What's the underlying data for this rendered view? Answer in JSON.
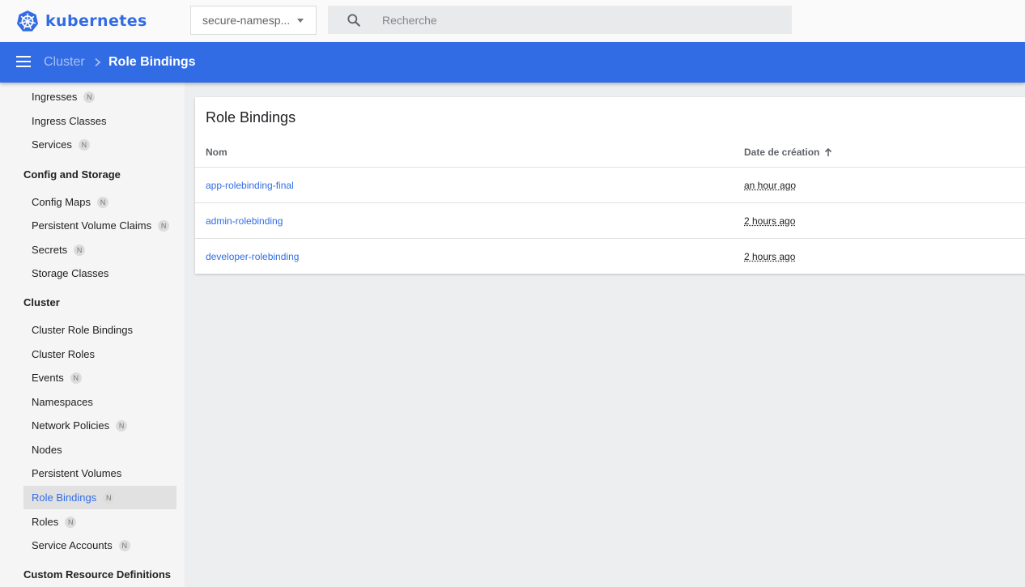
{
  "app": {
    "name": "kubernetes",
    "brand_color": "#326ce5"
  },
  "namespace_select": {
    "value": "secure-namespace",
    "display": "secure-namesp..."
  },
  "search": {
    "placeholder": "Recherche",
    "value": ""
  },
  "breadcrumb": {
    "parent": "Cluster",
    "current": "Role Bindings"
  },
  "sidebar": {
    "items": [
      {
        "label": "Ingresses",
        "badge": "N"
      },
      {
        "label": "Ingress Classes",
        "badge": ""
      },
      {
        "label": "Services",
        "badge": "N"
      },
      {
        "group": "Config and Storage"
      },
      {
        "label": "Config Maps",
        "badge": "N"
      },
      {
        "label": "Persistent Volume Claims",
        "badge": "N"
      },
      {
        "label": "Secrets",
        "badge": "N"
      },
      {
        "label": "Storage Classes",
        "badge": ""
      },
      {
        "group": "Cluster"
      },
      {
        "label": "Cluster Role Bindings",
        "badge": ""
      },
      {
        "label": "Cluster Roles",
        "badge": ""
      },
      {
        "label": "Events",
        "badge": "N"
      },
      {
        "label": "Namespaces",
        "badge": ""
      },
      {
        "label": "Network Policies",
        "badge": "N"
      },
      {
        "label": "Nodes",
        "badge": ""
      },
      {
        "label": "Persistent Volumes",
        "badge": ""
      },
      {
        "label": "Role Bindings",
        "badge": "N",
        "active": true
      },
      {
        "label": "Roles",
        "badge": "N"
      },
      {
        "label": "Service Accounts",
        "badge": "N"
      },
      {
        "group": "Custom Resource Definitions"
      }
    ]
  },
  "card": {
    "title": "Role Bindings",
    "columns": {
      "name": "Nom",
      "created": "Date de création"
    },
    "sort": {
      "column": "created",
      "direction": "ascending"
    },
    "rows": [
      {
        "name": "app-rolebinding-final",
        "created": "an hour ago"
      },
      {
        "name": "admin-rolebinding",
        "created": "2 hours ago"
      },
      {
        "name": "developer-rolebinding",
        "created": "2 hours ago"
      }
    ]
  }
}
